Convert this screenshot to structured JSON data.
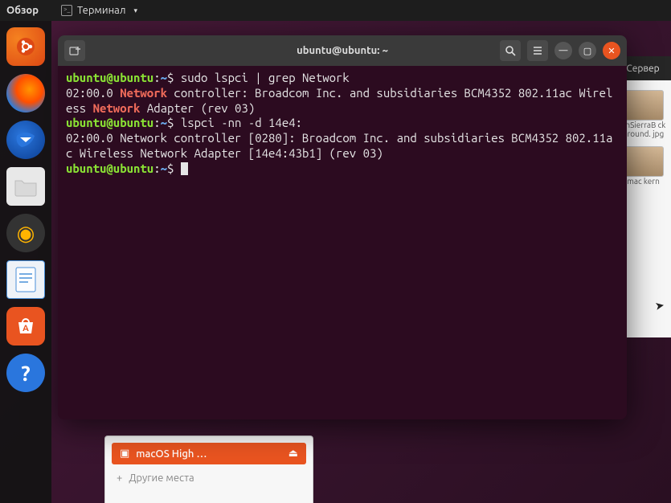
{
  "top_panel": {
    "activities": "Обзор",
    "active_app": "Терминал"
  },
  "dock": {
    "items": [
      {
        "name": "show-applications",
        "glyph": "⋮⋮⋮"
      },
      {
        "name": "firefox",
        "glyph": ""
      },
      {
        "name": "thunderbird",
        "glyph": ""
      },
      {
        "name": "files",
        "glyph": "🗂"
      },
      {
        "name": "rhythmbox",
        "glyph": "◉"
      },
      {
        "name": "libreoffice-writer",
        "glyph": "📄"
      },
      {
        "name": "ubuntu-software",
        "glyph": "A"
      },
      {
        "name": "help",
        "glyph": "?"
      }
    ]
  },
  "terminal": {
    "title": "ubuntu@ubuntu: ~",
    "prompt_user": "ubuntu@ubuntu",
    "prompt_path": "~",
    "prompt_symbol": "$",
    "lines": {
      "cmd1": "sudo lspci | grep Network",
      "out1a": "02:00.0 ",
      "out1b": "Network",
      "out1c": " controller: Broadcom Inc. and subsidiaries BCM4352 802.11ac Wireless ",
      "out1d": "Network",
      "out1e": " Adapter (rev 03)",
      "cmd2": "lspci -nn -d 14e4:",
      "out2": "02:00.0 Network controller [0280]: Broadcom Inc. and subsidiaries BCM4352 802.11ac Wireless Network Adapter [14e4:43b1] (rev 03)"
    }
  },
  "fm_peek": {
    "header": "Сервер",
    "file1": "ghSierraB\nckground.\njpg",
    "file2": "mac\nkern"
  },
  "sidebar_peek": {
    "usb_label": "macOS High …",
    "other_places": "Другие места"
  }
}
